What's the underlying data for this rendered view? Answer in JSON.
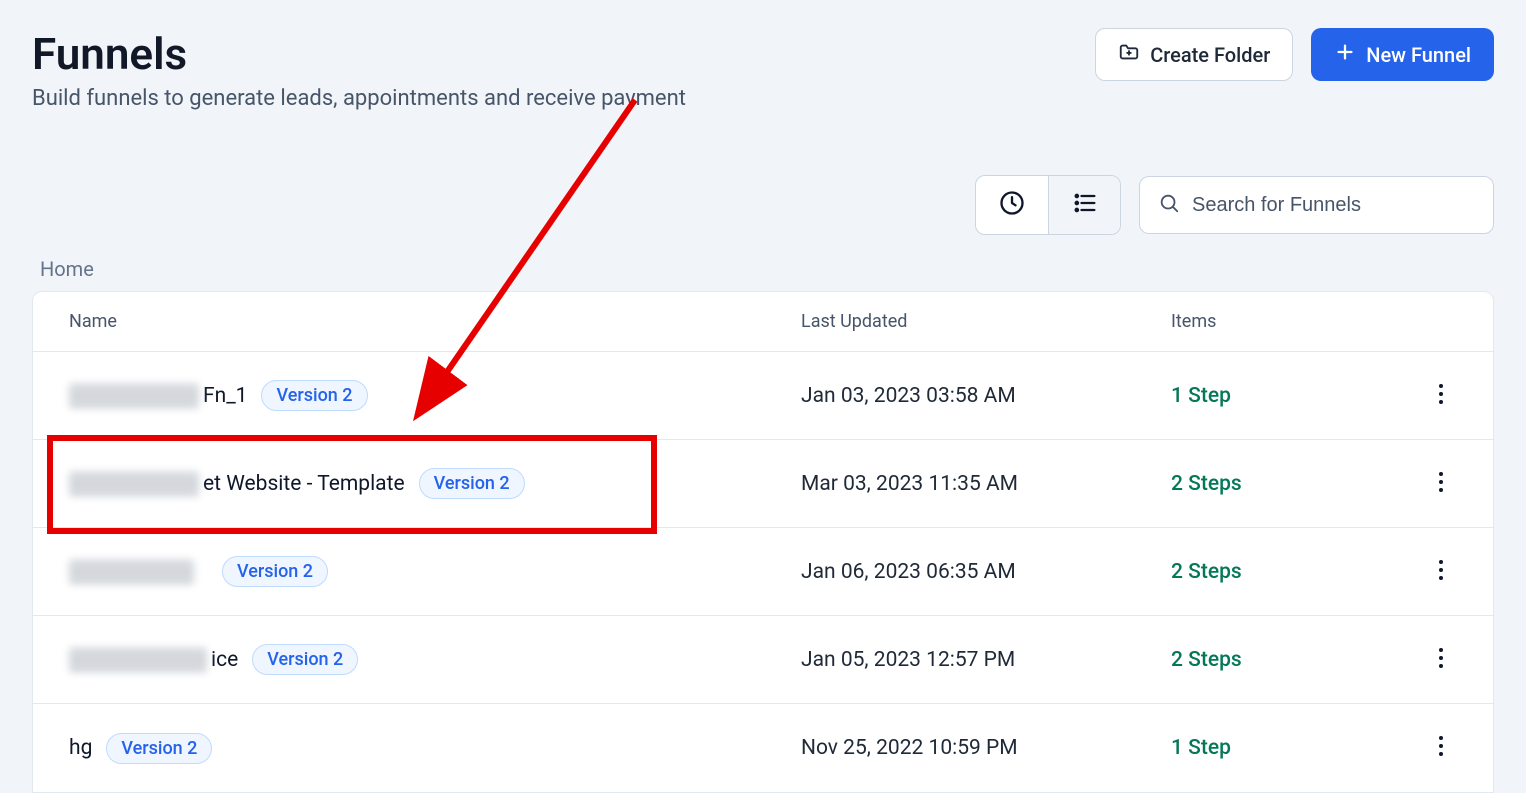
{
  "header": {
    "title": "Funnels",
    "subtitle": "Build funnels to generate leads, appointments and receive payment",
    "create_folder_label": "Create Folder",
    "new_funnel_label": "New Funnel"
  },
  "toolbar": {
    "search_placeholder": "Search for Funnels"
  },
  "breadcrumb": {
    "home_label": "Home"
  },
  "table": {
    "columns": {
      "name": "Name",
      "updated": "Last Updated",
      "items": "Items"
    },
    "version_badge": "Version 2",
    "rows": [
      {
        "name_prefix_redacted": true,
        "name_suffix": "Fn_1",
        "updated": "Jan 03, 2023 03:58 AM",
        "items": "1 Step"
      },
      {
        "name_prefix_redacted": true,
        "name_suffix": "et Website - Template",
        "updated": "Mar 03, 2023 11:35 AM",
        "items": "2 Steps",
        "highlighted": true
      },
      {
        "name_prefix_redacted": true,
        "name_suffix": "",
        "updated": "Jan 06, 2023 06:35 AM",
        "items": "2 Steps"
      },
      {
        "name_prefix_redacted": true,
        "name_suffix": "ice",
        "updated": "Jan 05, 2023 12:57 PM",
        "items": "2 Steps"
      },
      {
        "name_prefix_redacted": false,
        "name_suffix": "hg",
        "updated": "Nov 25, 2022 10:59 PM",
        "items": "1 Step"
      }
    ]
  }
}
